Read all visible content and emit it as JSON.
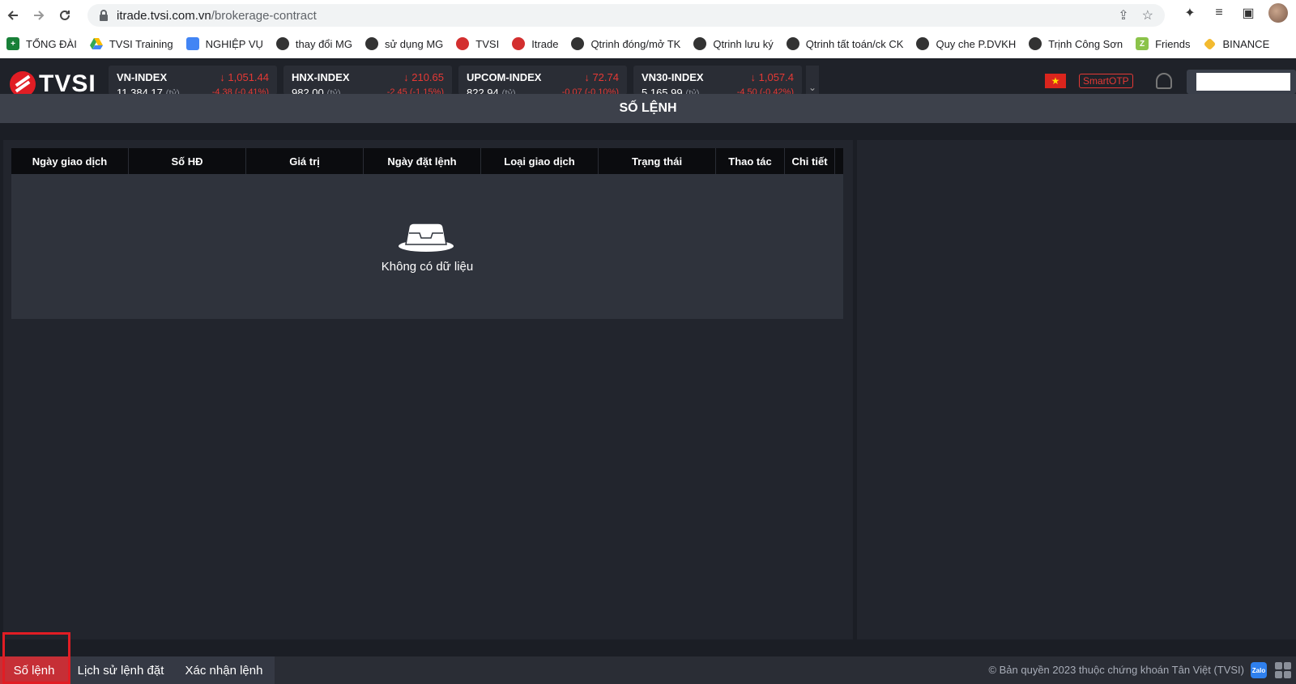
{
  "browser": {
    "url_host": "itrade.tvsi.com.vn",
    "url_path": "/brokerage-contract",
    "bookmarks": [
      {
        "label": "TỔNG ĐÀI",
        "icon": "sheets-icon"
      },
      {
        "label": "TVSI Training",
        "icon": "drive-icon"
      },
      {
        "label": "NGHIỆP VỤ",
        "icon": "docs-icon"
      },
      {
        "label": "thay đổi MG",
        "icon": "globe-icon"
      },
      {
        "label": "sử dụng MG",
        "icon": "globe-icon"
      },
      {
        "label": "TVSI",
        "icon": "tvsi-icon"
      },
      {
        "label": "Itrade",
        "icon": "tvsi-icon"
      },
      {
        "label": "Qtrinh đóng/mở TK",
        "icon": "globe-icon"
      },
      {
        "label": "Qtrinh lưu ký",
        "icon": "globe-icon"
      },
      {
        "label": "Qtrinh tất toán/ck CK",
        "icon": "globe-icon"
      },
      {
        "label": "Quy che P.DVKH",
        "icon": "globe-icon"
      },
      {
        "label": "Trịnh Công Sơn",
        "icon": "globe-icon"
      },
      {
        "label": "Friends",
        "icon": "zalo-z-icon"
      },
      {
        "label": "BINANCE",
        "icon": "binance-icon"
      }
    ]
  },
  "header": {
    "logo_text": "TVSI",
    "indexes": [
      {
        "name": "VN-INDEX",
        "value": "1,051.44",
        "volume": "11,384.17",
        "unit": "(tỷ)",
        "change": "-4.38 (-0.41%)"
      },
      {
        "name": "HNX-INDEX",
        "value": "210.65",
        "volume": "982.00",
        "unit": "(tỷ)",
        "change": "-2.45 (-1.15%)"
      },
      {
        "name": "UPCOM-INDEX",
        "value": "72.74",
        "volume": "822.94",
        "unit": "(tỷ)",
        "change": "-0.07 (-0.10%)"
      },
      {
        "name": "VN30-INDEX",
        "value": "1,057.4",
        "volume": "5,165.99",
        "unit": "(tỷ)",
        "change": "-4.50 (-0.42%)"
      }
    ],
    "smartotp_label": "SmartOTP"
  },
  "page": {
    "title": "SỐ LỆNH"
  },
  "table": {
    "columns": [
      "Ngày giao dịch",
      "Số HĐ",
      "Giá trị",
      "Ngày đặt lệnh",
      "Loại giao dịch",
      "Trạng thái",
      "Thao tác",
      "Chi tiết"
    ],
    "empty_message": "Không có dữ liệu"
  },
  "footer": {
    "tabs": [
      "Số lệnh",
      "Lịch sử lệnh đặt",
      "Xác nhận lệnh"
    ],
    "copyright": "© Bản quyền 2023 thuộc chứng khoán Tân Việt (TVSI)",
    "zalo_label": "Zalo"
  }
}
